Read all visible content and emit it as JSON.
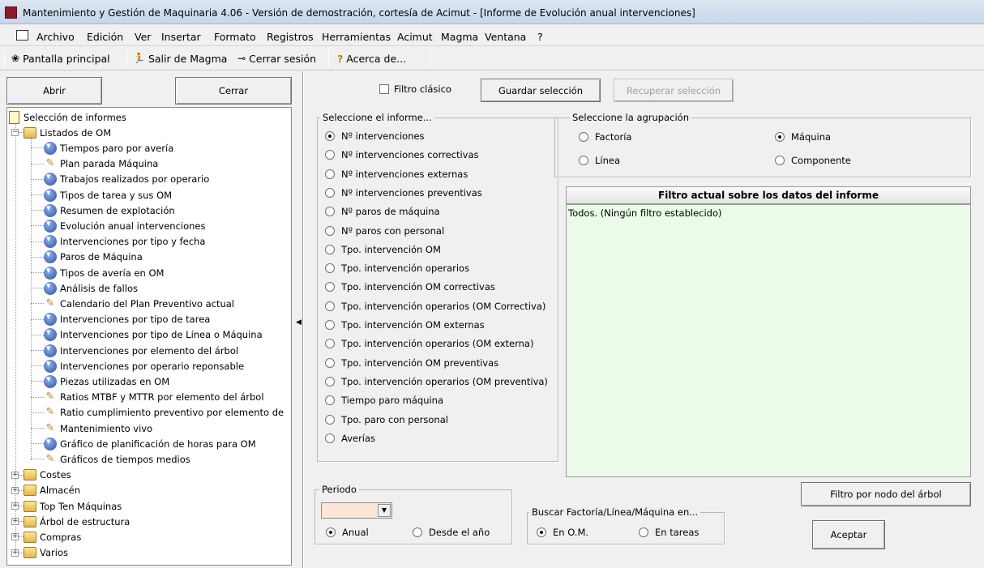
{
  "window": {
    "title": "Mantenimiento y Gestión de Maquinaria 4.06 - Versión de demostración, cortesía de Acimut - [Informe de Evolución anual intervenciones]"
  },
  "menu": {
    "items": [
      "Archivo",
      "Edición",
      "Ver",
      "Insertar",
      "Formato",
      "Registros",
      "Herramientas",
      "Acimut",
      "Magma",
      "Ventana",
      "?"
    ]
  },
  "toolbar": {
    "main_screen": "Pantalla principal",
    "exit": "Salir de Magma",
    "logout": "Cerrar sesión",
    "about": "Acerca de..."
  },
  "left_panel": {
    "open_label": "Abrir",
    "close_label": "Cerrar",
    "tree": {
      "root": "Selección de informes",
      "groups": [
        {
          "label": "Listados de OM",
          "expanded": true,
          "children": [
            {
              "label": "Tiempos paro por avería",
              "icon": "report-icon"
            },
            {
              "label": "Plan parada Máquina",
              "icon": "tools-icon"
            },
            {
              "label": "Trabajos realizados por operario",
              "icon": "report-icon"
            },
            {
              "label": "Tipos de tarea y sus OM",
              "icon": "report-icon"
            },
            {
              "label": "Resumen de explotación",
              "icon": "report-icon"
            },
            {
              "label": "Evolución anual intervenciones",
              "icon": "report-icon"
            },
            {
              "label": "Intervenciones por tipo y fecha",
              "icon": "report-icon"
            },
            {
              "label": "Paros de Máquina",
              "icon": "report-icon"
            },
            {
              "label": "Tipos de avería en OM",
              "icon": "report-icon"
            },
            {
              "label": "Análisis de fallos",
              "icon": "report-icon"
            },
            {
              "label": "Calendario del Plan Preventivo actual",
              "icon": "tools-icon"
            },
            {
              "label": "Intervenciones por tipo de tarea",
              "icon": "report-icon"
            },
            {
              "label": "Intervenciones por tipo de Línea o Máquina",
              "icon": "report-icon"
            },
            {
              "label": "Intervenciones por elemento del árbol",
              "icon": "report-icon"
            },
            {
              "label": "Intervenciones por operario reponsable",
              "icon": "report-icon"
            },
            {
              "label": "Piezas utilizadas en OM",
              "icon": "report-icon"
            },
            {
              "label": "Ratios MTBF y MTTR por elemento del árbol",
              "icon": "tools-icon"
            },
            {
              "label": "Ratio cumplimiento preventivo por elemento de",
              "icon": "tools-icon"
            },
            {
              "label": "Mantenimiento vivo",
              "icon": "tools-icon"
            },
            {
              "label": "Gráfico de planificación de horas para OM",
              "icon": "report-icon"
            },
            {
              "label": "Gráficos de tiempos medios",
              "icon": "tools-icon"
            }
          ]
        },
        {
          "label": "Costes",
          "expanded": false
        },
        {
          "label": "Almacén",
          "expanded": false
        },
        {
          "label": "Top Ten Máquinas",
          "expanded": false
        },
        {
          "label": "Árbol de estructura",
          "expanded": false
        },
        {
          "label": "Compras",
          "expanded": false
        },
        {
          "label": "Varios",
          "expanded": false
        }
      ]
    }
  },
  "top_controls": {
    "classic_filter": "Filtro clásico",
    "classic_filter_checked": false,
    "save_selection": "Guardar selección",
    "recover_selection": "Recuperar selección"
  },
  "report_select": {
    "title": "Seleccione el informe...",
    "selected_index": 0,
    "options": [
      "Nº intervenciones",
      "Nº intervenciones correctivas",
      "Nº intervenciones externas",
      "Nº intervenciones preventivas",
      "Nº paros de máquina",
      "Nº paros con personal",
      "Tpo. intervención OM",
      "Tpo. intervención operarios",
      "Tpo. intervención OM correctivas",
      "Tpo. intervención operarios (OM Correctiva)",
      "Tpo. intervención OM externas",
      "Tpo. intervención operarios (OM externa)",
      "Tpo. intervención OM preventivas",
      "Tpo. intervención operarios (OM preventiva)",
      "Tiempo paro máquina",
      "Tpo. paro con personal",
      "Averías"
    ]
  },
  "grouping": {
    "title": "Seleccione la agrupación",
    "factoria": "Factoría",
    "linea": "Línea",
    "maquina": "Máquina",
    "componente": "Componente",
    "selected": "Máquina"
  },
  "filter": {
    "header": "Filtro actual sobre los datos del informe",
    "text": "Todos. (Ningún filtro establecido)",
    "node_filter_button": "Filtro por nodo del árbol"
  },
  "period": {
    "title": "Periodo",
    "year_value": "",
    "annual": "Anual",
    "since_year": "Desde el año",
    "selected": "Anual"
  },
  "search": {
    "title": "Buscar Factoría/Línea/Máquina en...",
    "in_om": "En O.M.",
    "in_tasks": "En tareas",
    "selected": "En O.M."
  },
  "accept_label": "Aceptar",
  "colors": {
    "filter_bg": "#eafbe8",
    "combo_bg": "#fde5d8",
    "title_gradient_top": "#dbe6f3"
  }
}
